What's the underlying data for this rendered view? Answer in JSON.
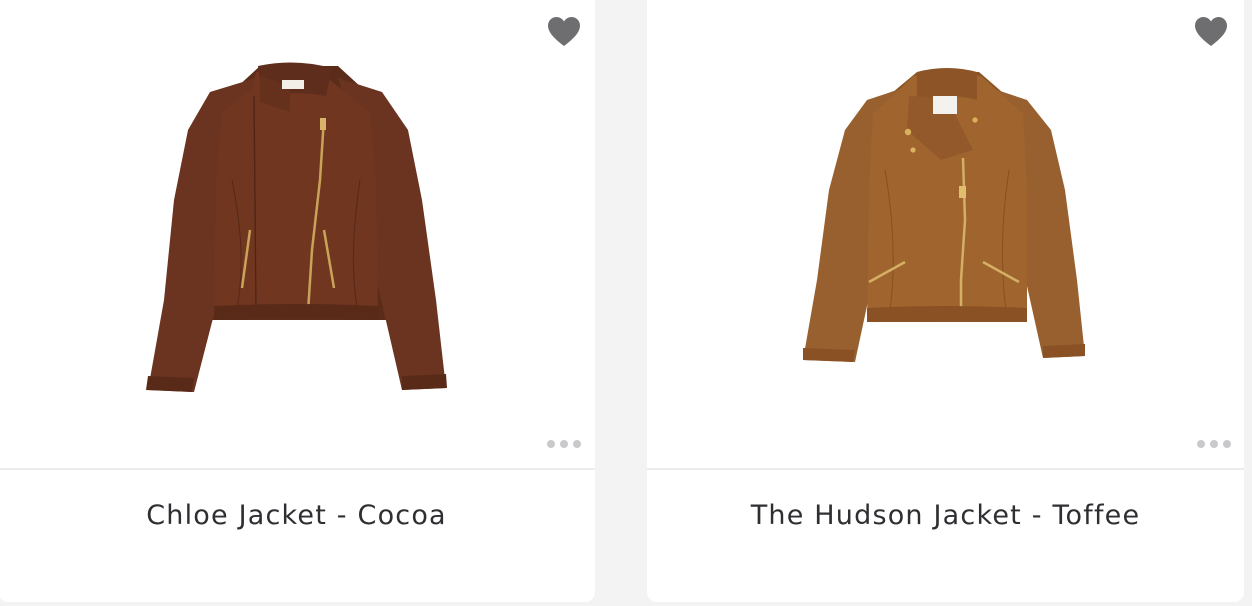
{
  "products": [
    {
      "name": "Chloe Jacket - Cocoa",
      "image_alt": "Chloe Jacket - Cocoa",
      "favorite_icon": "heart-icon",
      "more_icon": "more-dots-icon",
      "color": "#6b3420"
    },
    {
      "name": "The Hudson Jacket - Toffee",
      "image_alt": "The Hudson Jacket - Toffee",
      "favorite_icon": "heart-icon",
      "more_icon": "more-dots-icon",
      "color": "#9a6130"
    }
  ],
  "colors": {
    "heart": "#6e6e70",
    "dots": "#c9c9cc",
    "title_text": "#2f2f33",
    "background": "#f3f3f4"
  }
}
